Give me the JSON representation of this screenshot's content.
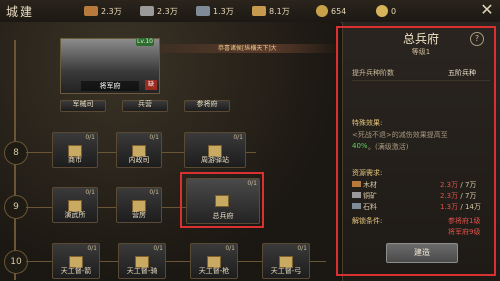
{
  "header": {
    "title": "城建",
    "resources": [
      {
        "icon": "wood-icon",
        "value": "2.3万",
        "color": "#b87a3c"
      },
      {
        "icon": "ingot-icon",
        "value": "2.3万",
        "color": "#9a9a9a"
      },
      {
        "icon": "stone-icon",
        "value": "1.3万",
        "color": "#7f8c98"
      },
      {
        "icon": "scroll-icon",
        "value": "8.1万",
        "color": "#c69a4e"
      },
      {
        "icon": "coin-icon",
        "value": "654",
        "color": "#c8a24a"
      },
      {
        "icon": "gem-icon",
        "value": "0",
        "color": "#d7b45a"
      }
    ]
  },
  "tree": {
    "hero": {
      "name": "将军府",
      "level_tag": "Lv.10",
      "red_tag": "缺"
    },
    "banner": "恭喜诸侯[纵横天下]大",
    "row_top": [
      "军械司",
      "兵营",
      "参将府"
    ],
    "levels": [
      "8",
      "9",
      "10"
    ],
    "row8": [
      "商市",
      "内政司",
      "周游驿站"
    ],
    "row9": [
      "演武所",
      "营房",
      "总兵府"
    ],
    "row10": [
      "天工督-箭",
      "天工督-骑",
      "天工督-枪",
      "天工督-弓"
    ],
    "small_tag": "0/1"
  },
  "panel": {
    "title": "总兵府",
    "level": "等级1",
    "effect_label": "提升兵种阶数",
    "effect_value": "五阶兵种",
    "special_label": "特殊效果:",
    "special_text": "<死战不退>的减伤效果提高至",
    "special_value": "40%",
    "special_suffix": "。(满级激活)",
    "res_label": "资源需求:",
    "resources": [
      {
        "name": "木材",
        "have": "2.3万",
        "need": "7万"
      },
      {
        "name": "铜矿",
        "have": "2.3万",
        "need": "7万"
      },
      {
        "name": "石料",
        "have": "1.3万",
        "need": "14万"
      }
    ],
    "unlock_label": "解锁条件:",
    "unlock_conditions": [
      "参将府1级",
      "将军府9级"
    ],
    "build_button": "建造"
  }
}
